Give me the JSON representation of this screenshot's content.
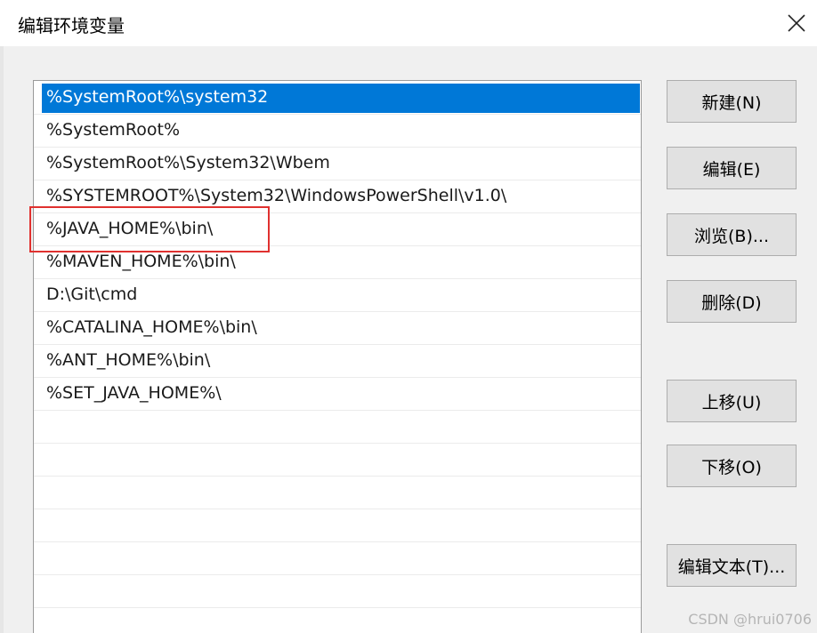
{
  "dialog": {
    "title": "编辑环境变量"
  },
  "path_list": {
    "selected_index": 0,
    "highlighted_index": 4,
    "items": [
      "%SystemRoot%\\system32",
      "%SystemRoot%",
      "%SystemRoot%\\System32\\Wbem",
      "%SYSTEMROOT%\\System32\\WindowsPowerShell\\v1.0\\",
      "%JAVA_HOME%\\bin\\",
      "%MAVEN_HOME%\\bin\\",
      "D:\\Git\\cmd",
      "%CATALINA_HOME%\\bin\\",
      "%ANT_HOME%\\bin\\",
      "%SET_JAVA_HOME%\\",
      "",
      "",
      "",
      "",
      "",
      "",
      ""
    ]
  },
  "buttons": {
    "new": "新建(N)",
    "edit": "编辑(E)",
    "browse": "浏览(B)...",
    "delete": "删除(D)",
    "move_up": "上移(U)",
    "move_down": "下移(O)",
    "edit_text": "编辑文本(T)..."
  },
  "watermark": "CSDN @hrui0706",
  "colors": {
    "selection": "#0078d7",
    "annotation": "#e0312f"
  },
  "icons": {
    "close": "close-icon"
  }
}
